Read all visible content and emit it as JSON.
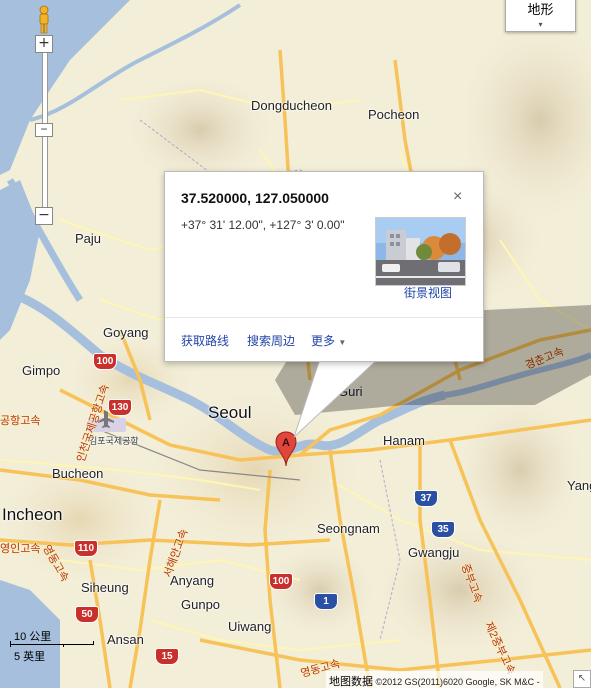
{
  "map_type": {
    "label": "地形",
    "arrow": "▾"
  },
  "zoom": {
    "plus": "+",
    "minus": "−",
    "slider": "−",
    "slider2": "−"
  },
  "places": {
    "dongducheon": "Dongducheon",
    "pocheon": "Pocheon",
    "paju": "Paju",
    "goyang": "Goyang",
    "gimpo": "Gimpo",
    "seoul": "Seoul",
    "guri": "Guri",
    "hanam": "Hanam",
    "bucheon": "Bucheon",
    "incheon": "Incheon",
    "seongnam": "Seongnam",
    "gwangju": "Gwangju",
    "anyang": "Anyang",
    "siheung": "Siheung",
    "gunpo": "Gunpo",
    "uiwang": "Uiwang",
    "ansan": "Ansan",
    "yang": "Yang",
    "gimpo_airport": "김포국제공항"
  },
  "road_labels": {
    "r1": "경춘고속",
    "r2": "인천국제공항고속",
    "r3": "공항고속",
    "r4": "서해안고속",
    "r5": "영동고속",
    "r6": "중부고속",
    "r7": "제2중부고속",
    "r8": "영동고속",
    "r9": "영인고속"
  },
  "shields": {
    "s100a": "100",
    "s130": "130",
    "s100b": "100",
    "s110": "110",
    "s50": "50",
    "s15": "15",
    "s100c": "100",
    "s1": "1",
    "s37": "37",
    "s35": "35"
  },
  "info_window": {
    "coordinates": "37.520000, 127.050000",
    "dms": "+37° 31' 12.00\", +127° 3' 0.00\"",
    "close": "×",
    "street_view": "街景视图",
    "directions": "获取路线",
    "search_nearby": "搜索周边",
    "more": "更多"
  },
  "marker": {
    "letter": "A"
  },
  "scale": {
    "metric": "10 公里",
    "imperial": "5 英里"
  },
  "attribution": {
    "label": "地图数据",
    "text": "©2012 GS(2011)6020 Google, SK M&C -"
  },
  "corner": "↖",
  "colors": {
    "land": "#f3eed8",
    "water": "#a5bfdd",
    "highway": "#f7c257",
    "road": "#fff6b3",
    "urban": "#ecdfbd",
    "link": "#2145a8"
  }
}
